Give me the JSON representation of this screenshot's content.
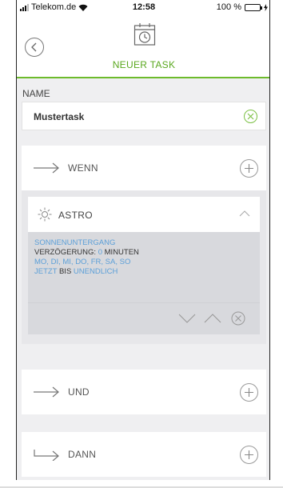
{
  "status_bar": {
    "carrier": "Telekom.de",
    "time": "12:58",
    "battery": "100 %",
    "battery_level": 1.0,
    "wifi_icon": "wifi-icon",
    "signal_icon": "signal-icon"
  },
  "header": {
    "title": "NEUER TASK",
    "back_icon": "chevron-left-icon",
    "calendar_icon": "calendar-clock-icon"
  },
  "name": {
    "label": "NAME",
    "value": "Mustertask",
    "clear_icon": "clear-circle-icon"
  },
  "wenn": {
    "label": "WENN",
    "add_icon": "plus-circle-icon"
  },
  "astro": {
    "title": "ASTRO",
    "icon": "sun-icon",
    "event": "SONNENUNTERGANG",
    "delay_label": "VERZÖGERUNG:",
    "delay_value": "0",
    "delay_unit": "MINUTEN",
    "days": "MO, DI, MI, DO, FR, SA, SO",
    "start": "JETZT",
    "until_word": "BIS",
    "end": "UNENDLICH"
  },
  "und": {
    "label": "UND",
    "add_icon": "plus-circle-icon"
  },
  "dann": {
    "label": "DANN",
    "add_icon": "plus-circle-icon"
  },
  "colors": {
    "accent_green": "#6dbb2c",
    "link_blue": "#5b9fd8",
    "background": "#efeff1"
  }
}
